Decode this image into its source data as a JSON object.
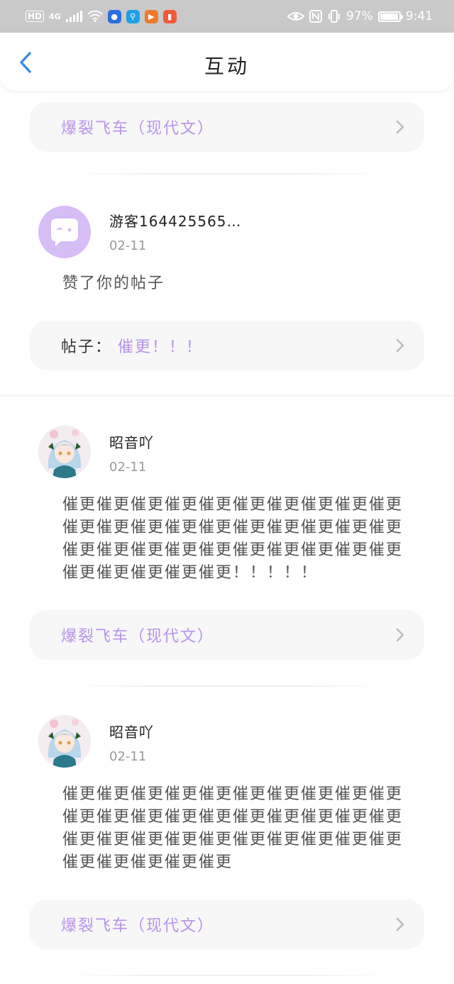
{
  "status_bar": {
    "hd": "HD",
    "network": "4G",
    "battery_percent": "97%",
    "time": "9:41",
    "battery_level": 0.97
  },
  "header": {
    "title": "互动",
    "back_icon": "chevron-left-icon"
  },
  "colors": {
    "accent": "#b794e8",
    "back_arrow": "#3a8ee6",
    "avatar_bg": "#d6bdf5"
  },
  "items": [
    {
      "ref_title": "爆裂飞车（现代文）"
    },
    {
      "user": "游客164425565…",
      "date": "02-11",
      "message": "赞了你的帖子",
      "ref_prefix": "帖子：",
      "ref_title": "催更！！！"
    },
    {
      "user": "昭音吖",
      "date": "02-11",
      "message": "催更催更催更催更催更催更催更催更催更催更催更催更催更催更催更催更催更催更催更催更催更催更催更催更催更催更催更催更催更催更催更催更催更催更催更！！！！！",
      "ref_title": "爆裂飞车（现代文）"
    },
    {
      "user": "昭音吖",
      "date": "02-11",
      "message": "催更催更催更催更催更催更催更催更催更催更催更催更催更催更催更催更催更催更催更催更催更催更催更催更催更催更催更催更催更催更催更催更催更催更催更",
      "ref_title": "爆裂飞车（现代文）"
    }
  ]
}
